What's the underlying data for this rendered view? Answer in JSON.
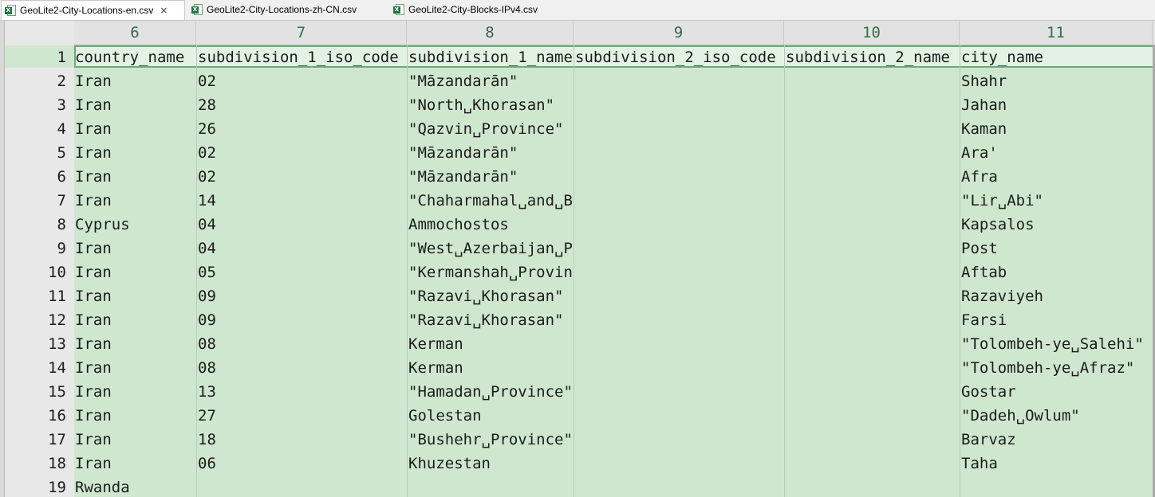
{
  "tabs": [
    {
      "label": "GeoLite2-City-Locations-en.csv",
      "active": true,
      "close": "×"
    },
    {
      "label": "GeoLite2-City-Locations-zh-CN.csv",
      "active": false
    },
    {
      "label": "GeoLite2-City-Blocks-IPv4.csv",
      "active": false
    }
  ],
  "columns": [
    "6",
    "7",
    "8",
    "9",
    "10",
    "11"
  ],
  "row_numbers": [
    "1",
    "2",
    "3",
    "4",
    "5",
    "6",
    "7",
    "8",
    "9",
    "10",
    "11",
    "12",
    "13",
    "14",
    "15",
    "16",
    "17",
    "18",
    "19"
  ],
  "rows": [
    [
      "country_name",
      "subdivision_1_iso_code",
      "subdivision_1_name",
      "subdivision_2_iso_code",
      "subdivision_2_name",
      "city_name"
    ],
    [
      "Iran",
      "02",
      "\"Māzandarān\"",
      "",
      "",
      "Shahr"
    ],
    [
      "Iran",
      "28",
      "\"North␣Khorasan\"",
      "",
      "",
      "Jahan"
    ],
    [
      "Iran",
      "26",
      "\"Qazvin␣Province\"",
      "",
      "",
      "Kaman"
    ],
    [
      "Iran",
      "02",
      "\"Māzandarān\"",
      "",
      "",
      "Ara'"
    ],
    [
      "Iran",
      "02",
      "\"Māzandarān\"",
      "",
      "",
      "Afra"
    ],
    [
      "Iran",
      "14",
      "\"Chaharmahal␣and␣Ba",
      "",
      "",
      "\"Lir␣Abi\""
    ],
    [
      "Cyprus",
      "04",
      "Ammochostos",
      "",
      "",
      "Kapsalos"
    ],
    [
      "Iran",
      "04",
      "\"West␣Azerbaijan␣Pr",
      "",
      "",
      "Post"
    ],
    [
      "Iran",
      "05",
      "\"Kermanshah␣Provinc",
      "",
      "",
      "Aftab"
    ],
    [
      "Iran",
      "09",
      "\"Razavi␣Khorasan\"",
      "",
      "",
      "Razaviyeh"
    ],
    [
      "Iran",
      "09",
      "\"Razavi␣Khorasan\"",
      "",
      "",
      "Farsi"
    ],
    [
      "Iran",
      "08",
      "Kerman",
      "",
      "",
      "\"Tolombeh-ye␣Salehi\""
    ],
    [
      "Iran",
      "08",
      "Kerman",
      "",
      "",
      "\"Tolombeh-ye␣Afraz\""
    ],
    [
      "Iran",
      "13",
      "\"Hamadan␣Province\"",
      "",
      "",
      "Gostar"
    ],
    [
      "Iran",
      "27",
      "Golestan",
      "",
      "",
      "\"Dadeh␣Owlum\""
    ],
    [
      "Iran",
      "18",
      "\"Bushehr␣Province\"",
      "",
      "",
      "Barvaz"
    ],
    [
      "Iran",
      "06",
      "Khuzestan",
      "",
      "",
      "Taha"
    ],
    [
      "Rwanda",
      "",
      "",
      "",
      "",
      ""
    ]
  ]
}
